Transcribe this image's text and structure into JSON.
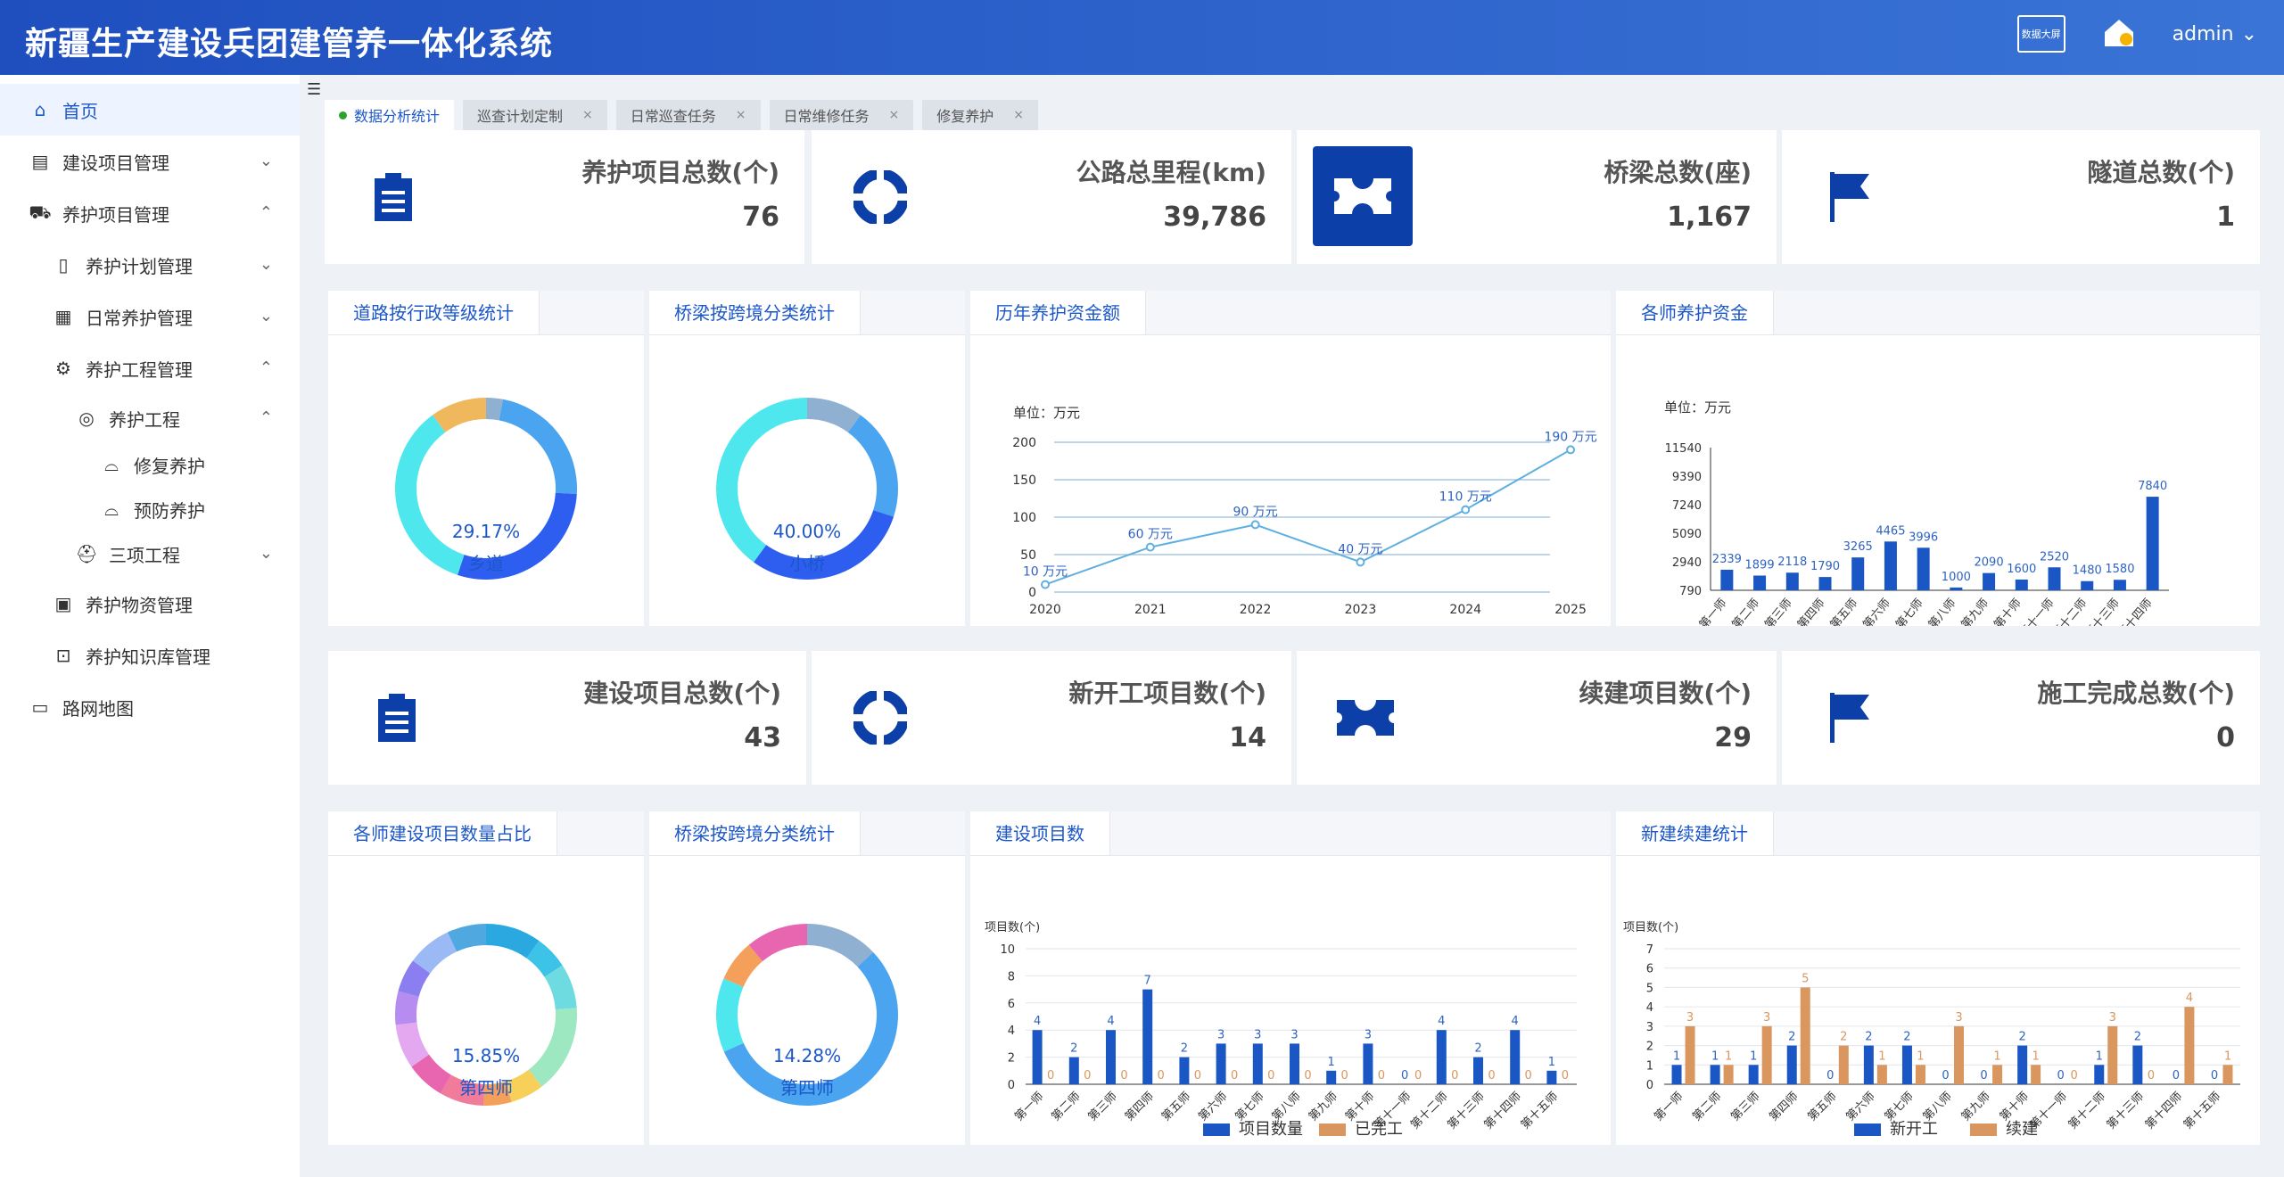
{
  "header": {
    "title": "新疆生产建设兵团建管养一体化系统",
    "screen_btn": "数据大屏",
    "user": "admin"
  },
  "sidebar": {
    "items": [
      {
        "label": "首页",
        "icon": "home-icon"
      },
      {
        "label": "建设项目管理",
        "icon": "clipboard-icon"
      },
      {
        "label": "养护项目管理",
        "icon": "truck-icon"
      },
      {
        "label": "养护计划管理",
        "icon": "document-icon"
      },
      {
        "label": "日常养护管理",
        "icon": "calendar-icon"
      },
      {
        "label": "养护工程管理",
        "icon": "gear-icon"
      },
      {
        "label": "养护工程",
        "icon": "location-icon"
      },
      {
        "label": "修复养护",
        "icon": "bell-icon"
      },
      {
        "label": "预防养护",
        "icon": "bell-icon"
      },
      {
        "label": "三项工程",
        "icon": "hat-icon"
      },
      {
        "label": "养护物资管理",
        "icon": "box-icon"
      },
      {
        "label": "养护知识库管理",
        "icon": "chip-icon"
      },
      {
        "label": "路网地图",
        "icon": "monitor-icon"
      }
    ]
  },
  "tabs": [
    "数据分析统计",
    "巡查计划定制",
    "日常巡查任务",
    "日常维修任务",
    "修复养护"
  ],
  "stats_top": [
    {
      "label": "养护项目总数(个)",
      "value": "76"
    },
    {
      "label": "公路总里程(km)",
      "value": "39,786"
    },
    {
      "label": "桥梁总数(座)",
      "value": "1,167"
    },
    {
      "label": "隧道总数(个)",
      "value": "1"
    }
  ],
  "stats_bottom": [
    {
      "label": "建设项目总数(个)",
      "value": "43"
    },
    {
      "label": "新开工项目数(个)",
      "value": "14"
    },
    {
      "label": "续建项目数(个)",
      "value": "29"
    },
    {
      "label": "施工完成总数(个)",
      "value": "0"
    }
  ],
  "panels": {
    "p1": {
      "title": "道路按行政等级统计",
      "pct": "29.17%",
      "name": "乡道"
    },
    "p2": {
      "title": "桥梁按跨境分类统计",
      "pct": "40.00%",
      "name": "小桥"
    },
    "p3": {
      "title": "历年养护资金额",
      "unit": "单位：万元"
    },
    "p4": {
      "title": "各师养护资金",
      "unit": "单位：万元"
    },
    "p5": {
      "title": "各师建设项目数量占比",
      "pct": "15.85%",
      "name": "第四师"
    },
    "p6": {
      "title": "桥梁按跨境分类统计",
      "pct": "14.28%",
      "name": "第四师"
    },
    "p7": {
      "title": "建设项目数",
      "unit": "项目数(个)"
    },
    "p8": {
      "title": "新建续建统计",
      "unit": "项目数(个)"
    }
  },
  "colors": {
    "primary": "#1c57c9",
    "bar_blue": "#1a56c4",
    "bar_orange": "#d9965e",
    "line": "#5fb0e0"
  },
  "chart_data": [
    {
      "type": "pie",
      "title": "道路按行政等级统计",
      "values": [
        3,
        23,
        29.17,
        35,
        10
      ],
      "colors": [
        "#8fb0d0",
        "#4aa4ef",
        "#2d5ef0",
        "#4ee7ee",
        "#f0b85c"
      ]
    },
    {
      "type": "pie",
      "title": "桥梁按跨境分类统计",
      "values": [
        10,
        20,
        30,
        40
      ],
      "colors": [
        "#8fb0d0",
        "#4aa4ef",
        "#2d5ef0",
        "#4ee7ee"
      ]
    },
    {
      "type": "line",
      "title": "历年养护资金额",
      "ylabel": "单位：万元",
      "x": [
        "2020",
        "2021",
        "2022",
        "2023",
        "2024",
        "2025"
      ],
      "values": [
        10,
        60,
        90,
        40,
        110,
        190
      ],
      "labels": [
        "10 万元",
        "60 万元",
        "90 万元",
        "40 万元",
        "110 万元",
        "190 万元"
      ],
      "ylim": [
        0,
        200
      ],
      "yticks": [
        0,
        50,
        100,
        150,
        200
      ]
    },
    {
      "type": "bar",
      "title": "各师养护资金",
      "ylabel": "单位：万元",
      "categories": [
        "第一师",
        "第二师",
        "第三师",
        "第四师",
        "第五师",
        "第六师",
        "第七师",
        "第八师",
        "第九师",
        "第十师",
        "第十一师",
        "第十二师",
        "第十三师",
        "第十四师"
      ],
      "values": [
        2339,
        1899,
        2118,
        1790,
        3265,
        4465,
        3996,
        1000,
        2090,
        1600,
        2520,
        1480,
        1580,
        7840
      ],
      "yticks": [
        790,
        2940,
        5090,
        7240,
        9390,
        11540
      ]
    },
    {
      "type": "pie",
      "title": "各师建设项目数量占比",
      "values": [
        10,
        6,
        8,
        15.85,
        6,
        5,
        8,
        7,
        8,
        6,
        6,
        8,
        7
      ],
      "colors": [
        "#2aa8e0",
        "#3ec3e8",
        "#6ddbe0",
        "#9de8c0",
        "#f7d05a",
        "#f5a05a",
        "#f07b9a",
        "#e866b0",
        "#e3a8f0",
        "#b68cf0",
        "#8a7ef0",
        "#9bb9f5",
        "#4fa8e0"
      ]
    },
    {
      "type": "pie",
      "title": "桥梁按跨境分类统计",
      "values": [
        14,
        60,
        14.28,
        8,
        12
      ],
      "colors": [
        "#8fb0d0",
        "#4aa4ef",
        "#4ee7ee",
        "#f5a05a",
        "#e866b0"
      ]
    },
    {
      "type": "bar",
      "title": "建设项目数",
      "ylabel": "项目数(个)",
      "categories": [
        "第一师",
        "第二师",
        "第三师",
        "第四师",
        "第五师",
        "第六师",
        "第七师",
        "第八师",
        "第九师",
        "第十师",
        "第十一师",
        "第十二师",
        "第十三师",
        "第十四师",
        "第十五师"
      ],
      "series": [
        {
          "name": "项目数量",
          "values": [
            4,
            2,
            4,
            7,
            2,
            3,
            3,
            3,
            1,
            3,
            0,
            4,
            2,
            4,
            1
          ]
        },
        {
          "name": "已完工",
          "values": [
            0,
            0,
            0,
            0,
            0,
            0,
            0,
            0,
            0,
            0,
            0,
            0,
            0,
            0,
            0
          ]
        }
      ],
      "ylim": [
        0,
        10
      ],
      "yticks": [
        0,
        2,
        4,
        6,
        8,
        10
      ]
    },
    {
      "type": "bar",
      "title": "新建续建统计",
      "ylabel": "项目数(个)",
      "categories": [
        "第一师",
        "第二师",
        "第三师",
        "第四师",
        "第五师",
        "第六师",
        "第七师",
        "第八师",
        "第九师",
        "第十师",
        "第十一师",
        "第十二师",
        "第十三师",
        "第十四师",
        "第十五师"
      ],
      "series": [
        {
          "name": "新开工",
          "values": [
            1,
            1,
            1,
            2,
            0,
            2,
            2,
            0,
            0,
            2,
            0,
            1,
            2,
            0,
            0
          ]
        },
        {
          "name": "续建",
          "values": [
            3,
            1,
            3,
            5,
            2,
            1,
            1,
            3,
            1,
            1,
            0,
            3,
            0,
            4,
            1
          ]
        }
      ],
      "ylim": [
        0,
        7
      ],
      "yticks": [
        0,
        1,
        2,
        3,
        4,
        5,
        6,
        7
      ]
    }
  ]
}
